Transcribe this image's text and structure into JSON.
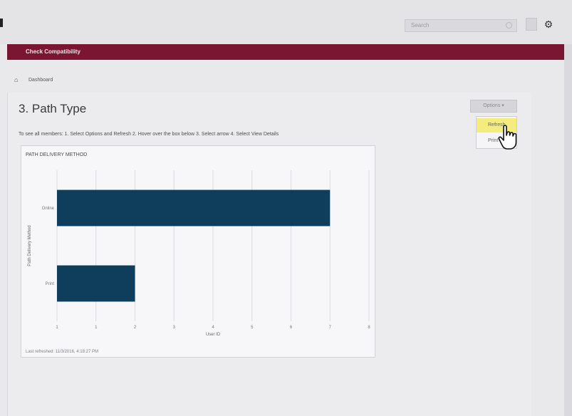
{
  "header": {
    "search_placeholder": "Search",
    "avatar_icon": "user-avatar-icon",
    "settings_icon": "gear-icon"
  },
  "app_band": {
    "title": "Check Compatibility",
    "color": "#7a1631"
  },
  "breadcrumb": {
    "home_icon": "home-icon",
    "items": [
      "Dashboard"
    ]
  },
  "page": {
    "title": "3. Path Type",
    "instructions": "To see all members: 1. Select Options and Refresh 2. Hover over the box below 3. Select arrow 4. Select View Details"
  },
  "options": {
    "label": "Options",
    "menu": [
      {
        "label": "Refresh",
        "highlighted": true
      },
      {
        "label": "Print",
        "highlighted": false
      }
    ]
  },
  "chart": {
    "title": "PATH DELIVERY METHOD",
    "last_refreshed": "Last refreshed: 11/3/2016, 4:18:27 PM"
  },
  "chart_data": {
    "type": "bar",
    "orientation": "horizontal",
    "title": "PATH DELIVERY METHOD",
    "categories": [
      "Online",
      "Print"
    ],
    "values": [
      7,
      2
    ],
    "xlabel": "User ID",
    "ylabel": "Path Delivery Method",
    "xlim": [
      0,
      8
    ],
    "xticks": [
      "1",
      "1",
      "2",
      "3",
      "4",
      "5",
      "6",
      "7",
      "8"
    ],
    "grid": true,
    "bar_color": "#0f3e5c"
  }
}
